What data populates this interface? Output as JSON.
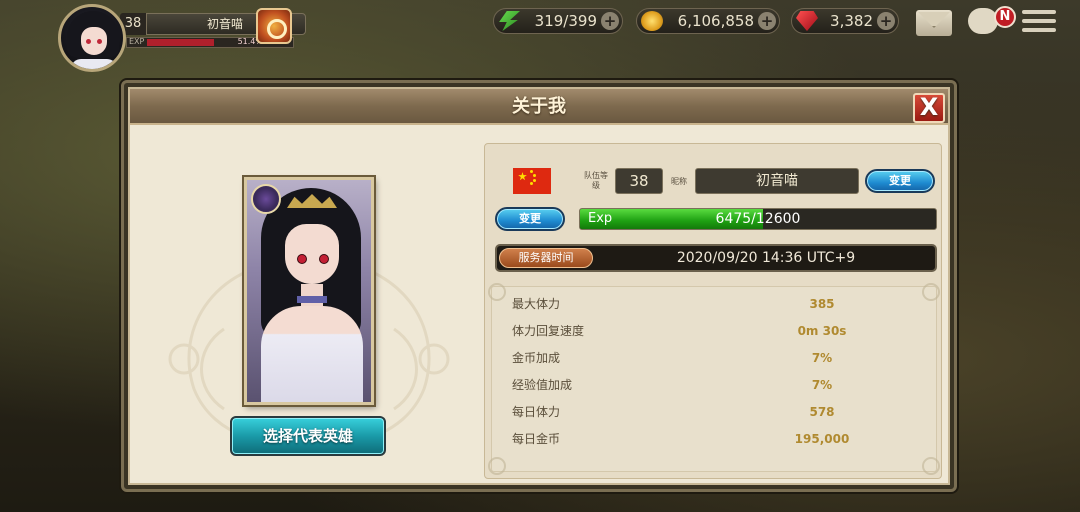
{
  "hud": {
    "level": "38",
    "name": "初音喵",
    "exp_label": "EXP",
    "exp_percent": "51.4%",
    "exp_fraction": 0.514,
    "energy": "319/399",
    "gold": "6,106,858",
    "gems": "3,382",
    "chat_badge": "N",
    "plus": "+"
  },
  "dialog": {
    "title": "关于我",
    "close": "X",
    "choose_hero": "选择代表英雄",
    "team_level_label": "队伍等级",
    "team_level": "38",
    "nickname_label": "昵称",
    "nickname": "初音喵",
    "change_name": "变更",
    "change_flag": "变更",
    "exp_label": "Exp",
    "exp_value": "6475/12600",
    "exp_fraction": 0.514,
    "server_time_label": "服务器时间",
    "server_time": "2020/09/20 14:36 UTC+9",
    "stats": [
      {
        "label": "最大体力",
        "value": "385"
      },
      {
        "label": "体力回复速度",
        "value": "0m 30s"
      },
      {
        "label": "金币加成",
        "value": "7%"
      },
      {
        "label": "经验值加成",
        "value": "7%"
      },
      {
        "label": "每日体力",
        "value": "578"
      },
      {
        "label": "每日金币",
        "value": "195,000"
      }
    ]
  },
  "colors": {
    "title_bar": "#7e6a4e",
    "panel_bg": "#efe8d6",
    "accent_gold": "#b08a30",
    "btn_cyan": "#1a9aa8",
    "exp_green": "#1ea012"
  },
  "icons": [
    "energy-icon",
    "gold-coin-icon",
    "ruby-gem-icon",
    "mail-icon",
    "chat-icon",
    "menu-icon",
    "event-icon",
    "close-icon",
    "flag-icon"
  ]
}
